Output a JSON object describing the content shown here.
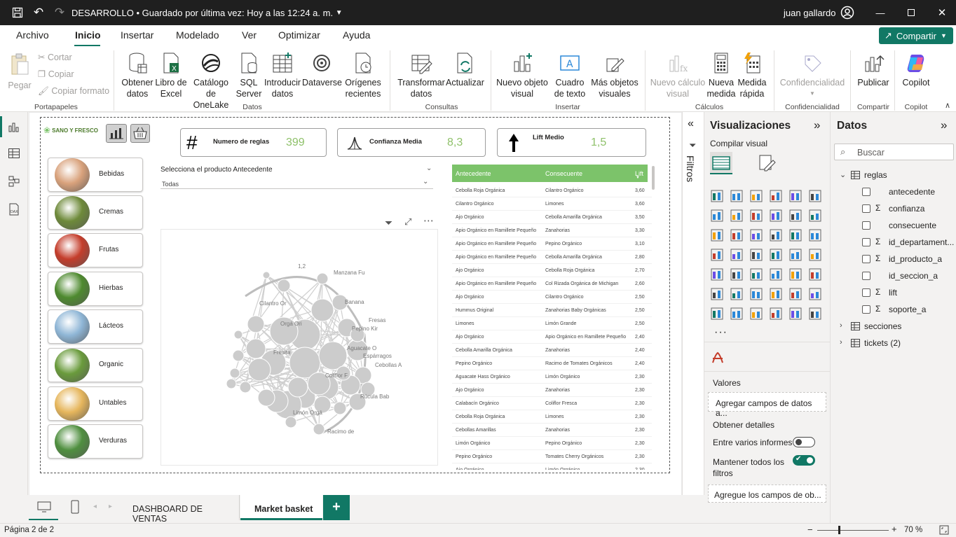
{
  "titlebar": {
    "title": "DESARROLLO",
    "saved": "• Guardado por última vez: Hoy a las 12:24 a. m.",
    "user": "juan gallardo"
  },
  "menu": {
    "tabs": [
      "Archivo",
      "Inicio",
      "Insertar",
      "Modelado",
      "Ver",
      "Optimizar",
      "Ayuda"
    ],
    "share": "Compartir"
  },
  "ribbon": {
    "clipboard": {
      "paste": "Pegar",
      "cut": "Cortar",
      "copy": "Copiar",
      "format": "Copiar formato",
      "group": "Portapapeles"
    },
    "data": {
      "get": "Obtener datos",
      "excel": "Libro de Excel",
      "onelake": "Catálogo de OneLake",
      "sql": "SQL Server",
      "enter": "Introducir datos",
      "dataverse": "Dataverse",
      "recent": "Orígenes recientes",
      "group": "Datos"
    },
    "queries": {
      "transform": "Transformar datos",
      "refresh": "Actualizar",
      "group": "Consultas"
    },
    "insert": {
      "visual": "Nuevo objeto visual",
      "textbox": "Cuadro de texto",
      "more": "Más objetos visuales",
      "group": "Insertar"
    },
    "calc": {
      "newcalc": "Nuevo cálculo visual",
      "measure": "Nueva medida",
      "quick": "Medida rápida",
      "group": "Cálculos"
    },
    "sens": {
      "label": "Confidencialidad",
      "group": "Confidencialidad"
    },
    "share": {
      "publish": "Publicar",
      "group": "Compartir"
    },
    "copilot": {
      "label": "Copilot",
      "group": "Copilot"
    }
  },
  "report": {
    "brand": "SANO Y FRESCO",
    "categories": [
      "Bebidas",
      "Cremas",
      "Frutas",
      "Hierbas",
      "Lácteos",
      "Organic",
      "Untables",
      "Verduras"
    ],
    "category_colors": [
      "#d9a27c",
      "#6e8a3a",
      "#c43d2b",
      "#4e8a2f",
      "#8fb6d6",
      "#6a9b3c",
      "#e6b65c",
      "#4f8f3f"
    ],
    "kpis": [
      {
        "label": "Numero de reglas",
        "value": "399"
      },
      {
        "label": "Confianza Media",
        "value": "8,3"
      },
      {
        "label": "Lift Medio",
        "value": "1,5"
      }
    ],
    "slicer": {
      "title": "Selecciona el producto Antecedente",
      "value": "Todas"
    },
    "table": {
      "headers": [
        "Antecedente",
        "Consecuente",
        "Lift"
      ],
      "rows": [
        [
          "Cebolla Roja Orgánica",
          "Cilantro Orgánico",
          "3,60"
        ],
        [
          "Cilantro Orgánico",
          "Limones",
          "3,60"
        ],
        [
          "Ajo Orgánico",
          "Cebolla Amarilla Orgánica",
          "3,50"
        ],
        [
          "Apio Orgánico en Ramillete Pequeño",
          "Zanahorias",
          "3,30"
        ],
        [
          "Apio Orgánico en Ramillete Pequeño",
          "Pepino Orgánico",
          "3,10"
        ],
        [
          "Apio Orgánico en Ramillete Pequeño",
          "Cebolla Amarilla Orgánica",
          "2,80"
        ],
        [
          "Ajo Orgánico",
          "Cebolla Roja Orgánica",
          "2,70"
        ],
        [
          "Apio Orgánico en Ramillete Pequeño",
          "Col Rizada Orgánica de Michigan",
          "2,60"
        ],
        [
          "Ajo Orgánico",
          "Cilantro Orgánico",
          "2,50"
        ],
        [
          "Hummus Original",
          "Zanahorias Baby Orgánicas",
          "2,50"
        ],
        [
          "Limones",
          "Limón Grande",
          "2,50"
        ],
        [
          "Ajo Orgánico",
          "Apio Orgánico en Ramillete Pequeño",
          "2,40"
        ],
        [
          "Cebolla Amarilla Orgánica",
          "Zanahorias",
          "2,40"
        ],
        [
          "Pepino Orgánico",
          "Racimo de Tomates Orgánicos",
          "2,40"
        ],
        [
          "Aguacate Hass Orgánico",
          "Limón Orgánico",
          "2,30"
        ],
        [
          "Ajo Orgánico",
          "Zanahorias",
          "2,30"
        ],
        [
          "Calabacín Orgánico",
          "Coliflor Fresca",
          "2,30"
        ],
        [
          "Cebolla Roja Orgánica",
          "Limones",
          "2,30"
        ],
        [
          "Cebollas Amarillas",
          "Zanahorias",
          "2,30"
        ],
        [
          "Limón Orgánico",
          "Pepino Orgánico",
          "2,30"
        ],
        [
          "Pepino Orgánico",
          "Tomates Cherry Orgánicos",
          "2,30"
        ],
        [
          "Ajo Orgánico",
          "Limón Orgánico",
          "2,30"
        ]
      ]
    },
    "network_labels": [
      "1,2",
      "Manzana Fu",
      "Banana",
      "Fresas",
      "Pepino Kir",
      "Aguacate O",
      "Espárragos",
      "Cebollas A",
      "Coliflor F",
      "Rúcula Bab",
      "Limón Orgá",
      "Racimo de",
      "Cilantro Or",
      "Orgá",
      "Ori",
      "Fresita"
    ]
  },
  "filters": {
    "label": "Filtros"
  },
  "viz": {
    "title": "Visualizaciones",
    "build": "Compilar visual",
    "more": "...",
    "values": "Valores",
    "add_fields": "Agregar campos de datos a...",
    "details": "Obtener detalles",
    "cross_report": "Entre varios informes",
    "cross_state": "No",
    "keep_filters": "Mantener todos los filtros",
    "keep_state": "Sí",
    "drill": "Agregue los campos de ob..."
  },
  "datos": {
    "title": "Datos",
    "search": "Buscar",
    "tables": [
      {
        "name": "reglas",
        "expanded": true,
        "fields": [
          {
            "name": "antecedente",
            "sigma": false
          },
          {
            "name": "confianza",
            "sigma": true
          },
          {
            "name": "consecuente",
            "sigma": false
          },
          {
            "name": "id_departament...",
            "sigma": true
          },
          {
            "name": "id_producto_a",
            "sigma": true
          },
          {
            "name": "id_seccion_a",
            "sigma": false
          },
          {
            "name": "lift",
            "sigma": true
          },
          {
            "name": "soporte_a",
            "sigma": true
          }
        ]
      },
      {
        "name": "secciones",
        "expanded": false
      },
      {
        "name": "tickets (2)",
        "expanded": false
      }
    ]
  },
  "pages": {
    "tabs": [
      "DASHBOARD DE VENTAS",
      "Market basket"
    ],
    "add": "+"
  },
  "status": {
    "page": "Página 2 de 2",
    "zoom": "70 %"
  }
}
